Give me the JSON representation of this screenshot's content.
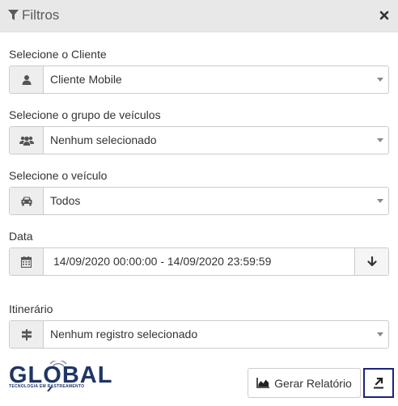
{
  "header": {
    "title": "Filtros"
  },
  "fields": {
    "cliente": {
      "label": "Selecione o Cliente",
      "value": "Cliente Mobile",
      "icon": "user-icon"
    },
    "grupo": {
      "label": "Selecione o grupo de veículos",
      "value": "Nenhum selecionado",
      "icon": "users-icon"
    },
    "veiculo": {
      "label": "Selecione o veículo",
      "value": "Todos",
      "icon": "car-icon"
    },
    "data": {
      "label": "Data",
      "value": "14/09/2020 00:00:00 - 14/09/2020 23:59:59",
      "icon": "calendar-icon"
    },
    "itinerario": {
      "label": "Itinerário",
      "value": "Nenhum registro selecionado",
      "icon": "signpost-icon"
    }
  },
  "logo": {
    "name": "GLOBAL",
    "tagline": "TECNOLOGIA EM RASTREAMENTO"
  },
  "actions": {
    "report_label": "Gerar Relatório"
  },
  "colors": {
    "accent": "#1a237e",
    "logo": "#1f3566",
    "header_bg": "#e8e8e8"
  }
}
